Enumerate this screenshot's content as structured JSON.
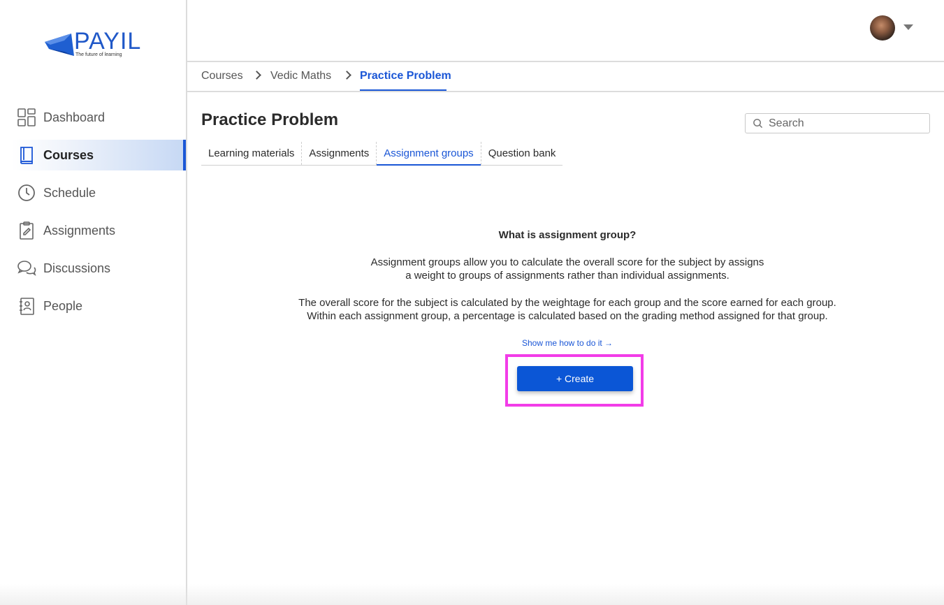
{
  "brand": {
    "name": "PAYIL",
    "tagline": "The future of learning",
    "accent_color": "#1a56d6"
  },
  "sidebar": {
    "items": [
      {
        "label": "Dashboard",
        "icon": "dashboard-icon",
        "active": false
      },
      {
        "label": "Courses",
        "icon": "book-icon",
        "active": true
      },
      {
        "label": "Schedule",
        "icon": "clock-icon",
        "active": false
      },
      {
        "label": "Assignments",
        "icon": "clipboard-icon",
        "active": false
      },
      {
        "label": "Discussions",
        "icon": "chat-bubbles-icon",
        "active": false
      },
      {
        "label": "People",
        "icon": "contact-book-icon",
        "active": false
      }
    ]
  },
  "header": {
    "avatar_icon": "user-avatar",
    "dropdown_icon": "caret-down-icon"
  },
  "breadcrumb": {
    "items": [
      "Courses",
      "Vedic Maths",
      "Practice Problem"
    ]
  },
  "page": {
    "title": "Practice Problem",
    "search_placeholder": "Search"
  },
  "tabs": {
    "items": [
      "Learning materials",
      "Assignments",
      "Assignment groups",
      "Question bank"
    ],
    "active": "Assignment groups"
  },
  "info": {
    "title": "What is assignment group?",
    "para1_line1": "Assignment groups allow you to calculate the overall score for the subject by assigns",
    "para1_line2": "a weight to groups of assignments rather than individual assignments.",
    "para2_line1": "The overall score for the subject is calculated by the weightage for each group and the score earned for each group.",
    "para2_line2": "Within each assignment group, a percentage is calculated based on the grading method assigned for that group.",
    "link": "Show me how to do it →",
    "create_button": "+ Create"
  }
}
